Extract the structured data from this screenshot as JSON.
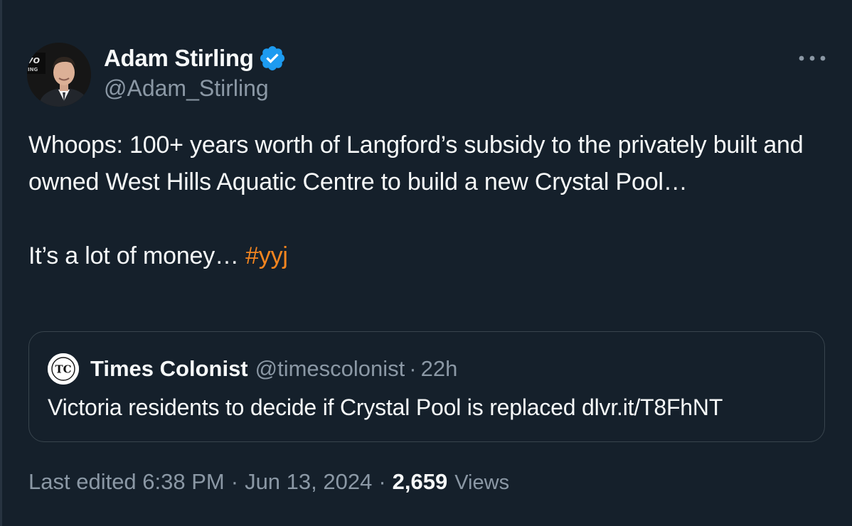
{
  "colors": {
    "background": "#15202b",
    "text_primary": "#f7f9f9",
    "text_secondary": "#8b98a5",
    "hashtag": "#f4851f",
    "verified_badge": "#1d9bf0",
    "card_border": "#38444d"
  },
  "author": {
    "name": "Adam Stirling",
    "handle": "@Adam_Stirling",
    "verified": true,
    "avatar_icon": "avatar-icon"
  },
  "tweet": {
    "paragraph_1": "Whoops: 100+ years worth of Langford’s subsidy to the privately built and owned West Hills Aquatic Centre to build a new Crystal Pool…",
    "paragraph_2": "It’s a lot of money… ",
    "hashtag": "#yyj"
  },
  "quote": {
    "logo_text": "TC",
    "name": "Times Colonist",
    "handle": "@timescolonist",
    "separator": "·",
    "time": "22h",
    "text": "Victoria residents to decide if Crystal Pool is replaced dlvr.it/T8FhNT"
  },
  "meta": {
    "edited": "Last edited 6:38 PM",
    "separator": "·",
    "date": "Jun 13, 2024",
    "views_count": "2,659",
    "views_label": "Views"
  },
  "icons": {
    "more": "more-horizontal-icon",
    "verified": "verified-badge-icon"
  }
}
